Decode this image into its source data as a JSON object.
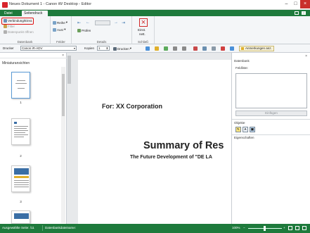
{
  "window": {
    "title": "Neues Dokument 1 - Canon iW Desktop - Editor"
  },
  "tabs": {
    "file": "Datei",
    "active": "Seitendruck"
  },
  "ribbon": {
    "datenbank": {
      "label": "Datenbank",
      "connect": "Verbindung/Einst.",
      "filter": "Filter",
      "open": "Datenpunkt öffnen"
    },
    "felder": {
      "label": "Felder",
      "insert": "Reihe",
      "display": "Ausr"
    },
    "details": {
      "label": "Details",
      "preview": "Prüfen"
    },
    "schliessen": {
      "label": "Schließ",
      "btn1": "Einst.",
      "btn2": "nett."
    }
  },
  "toolbar": {
    "printer_label": "Drucker",
    "printer_value": "Canon iR-ADV",
    "copies_label": "Kopien",
    "copies_value": "1",
    "print_button": "Drucken",
    "annotations_button": "Anmerkungen anz."
  },
  "left_pane": {
    "title": "Miniaturansichten",
    "page_numbers": [
      "1",
      "2",
      "3"
    ]
  },
  "document": {
    "for_line": "For: XX Corporation",
    "summary": "Summary of Res",
    "subtitle": "The Future Development of \"DE LA"
  },
  "right_pane": {
    "datenbank_label": "Datenbank",
    "feldliste_label": "Feldliste:",
    "insert_button": "Einfügen",
    "objekte_label": "Objekte",
    "eigenschaften_label": "Eigenschaften"
  },
  "status": {
    "selected": "Ausgewählte Seite: /11",
    "dbfile": "Datenbankdateiname:",
    "zoom": "100%"
  },
  "colors": {
    "brand": "#1e7a3c",
    "highlight": "#e01010",
    "close": "#c9302c"
  }
}
